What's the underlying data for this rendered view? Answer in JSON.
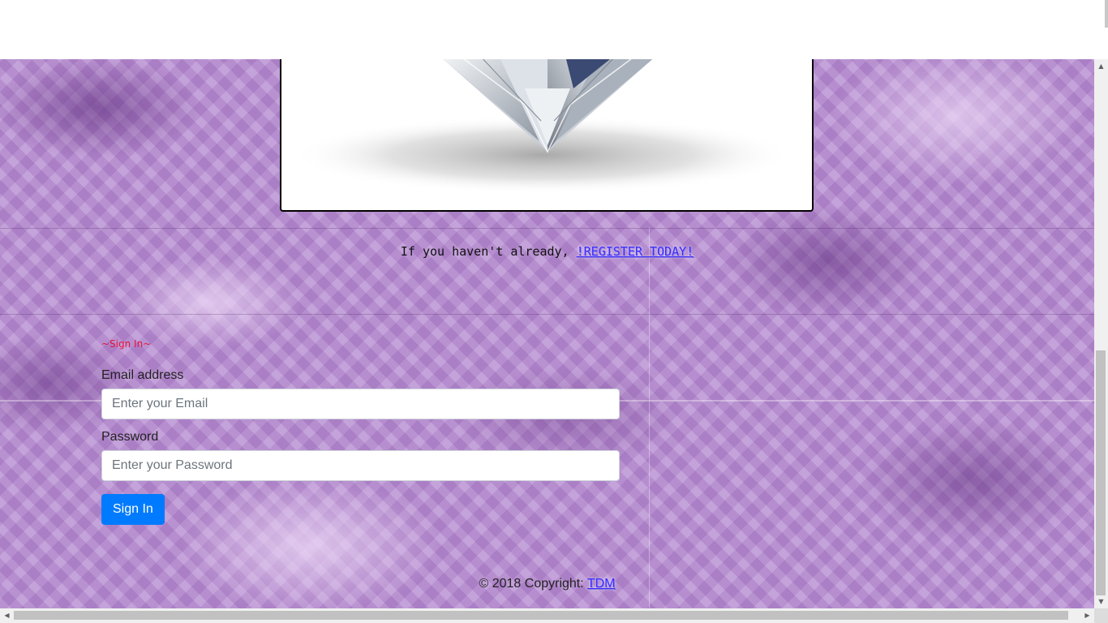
{
  "register": {
    "prefix": "If you haven't already, ",
    "link": "!REGISTER TODAY!"
  },
  "signin": {
    "heading": "~Sign In~",
    "email_label": "Email address",
    "email_placeholder": "Enter your Email",
    "password_label": "Password",
    "password_placeholder": "Enter your Password",
    "button_label": "Sign In"
  },
  "footer": {
    "copyright": "© 2018 Copyright: ",
    "link": "TDM"
  },
  "icons": {
    "scroll_up": "scroll-up-arrow-icon",
    "scroll_down": "scroll-down-arrow-icon",
    "scroll_left": "scroll-left-arrow-icon",
    "scroll_right": "scroll-right-arrow-icon"
  },
  "colors": {
    "primary_button": "#007bff",
    "heading_red": "#e8123c",
    "link_blue": "#3b2bff",
    "background_purple": "#b88fd2"
  }
}
